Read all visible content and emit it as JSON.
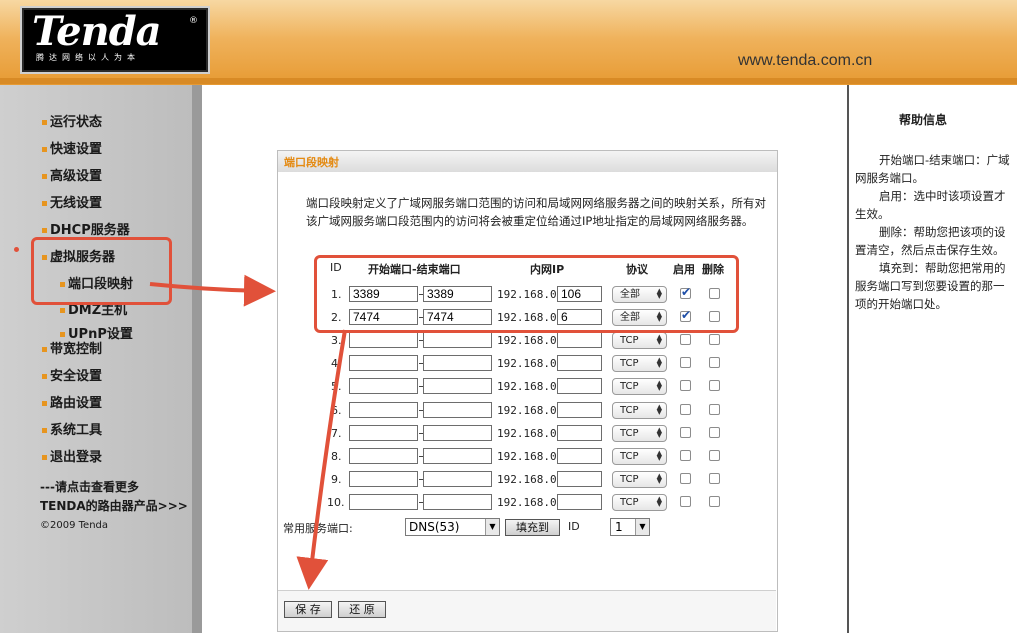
{
  "header": {
    "logo_text": "Tenda",
    "logo_reg": "®",
    "logo_sub": "腾达网络以人为本",
    "site_url": "www.tenda.com.cn"
  },
  "sidebar": {
    "items": [
      {
        "label": "运行状态"
      },
      {
        "label": "快速设置"
      },
      {
        "label": "高级设置"
      },
      {
        "label": "无线设置"
      },
      {
        "label": "DHCP服务器"
      },
      {
        "label": "虚拟服务器"
      },
      {
        "label": "端口段映射"
      },
      {
        "label": "DMZ主机"
      },
      {
        "label": "UPnP设置"
      },
      {
        "label": "带宽控制"
      },
      {
        "label": "安全设置"
      },
      {
        "label": "路由设置"
      },
      {
        "label": "系统工具"
      },
      {
        "label": "退出登录"
      }
    ],
    "more_line1": "---请点击查看更多",
    "more_line2": "TENDA的路由器产品>>>",
    "copyright": "©2009 Tenda"
  },
  "panel": {
    "title": "端口段映射",
    "description": "端口段映射定义了广域网服务端口范围的访问和局域网网络服务器之间的映射关系，所有对该广域网服务端口段范围内的访问将会被重定位给通过IP地址指定的局域网网络服务器。",
    "columns": {
      "id": "ID",
      "ports": "开始端口-结束端口",
      "ip": "内网IP",
      "protocol": "协议",
      "enable": "启用",
      "delete": "删除"
    },
    "ip_prefix": "192.168.0.",
    "rows": [
      {
        "id": "1.",
        "start": "3389",
        "end": "3389",
        "ip": "106",
        "protocol": "全部",
        "enabled": true,
        "deleted": false
      },
      {
        "id": "2.",
        "start": "7474",
        "end": "7474",
        "ip": "6",
        "protocol": "全部",
        "enabled": true,
        "deleted": false
      },
      {
        "id": "3.",
        "start": "",
        "end": "",
        "ip": "",
        "protocol": "TCP",
        "enabled": false,
        "deleted": false
      },
      {
        "id": "4.",
        "start": "",
        "end": "",
        "ip": "",
        "protocol": "TCP",
        "enabled": false,
        "deleted": false
      },
      {
        "id": "5.",
        "start": "",
        "end": "",
        "ip": "",
        "protocol": "TCP",
        "enabled": false,
        "deleted": false
      },
      {
        "id": "6.",
        "start": "",
        "end": "",
        "ip": "",
        "protocol": "TCP",
        "enabled": false,
        "deleted": false
      },
      {
        "id": "7.",
        "start": "",
        "end": "",
        "ip": "",
        "protocol": "TCP",
        "enabled": false,
        "deleted": false
      },
      {
        "id": "8.",
        "start": "",
        "end": "",
        "ip": "",
        "protocol": "TCP",
        "enabled": false,
        "deleted": false
      },
      {
        "id": "9.",
        "start": "",
        "end": "",
        "ip": "",
        "protocol": "TCP",
        "enabled": false,
        "deleted": false
      },
      {
        "id": "10.",
        "start": "",
        "end": "",
        "ip": "",
        "protocol": "TCP",
        "enabled": false,
        "deleted": false
      }
    ],
    "common_service_label": "常用服务端口:",
    "common_service_value": "DNS(53)",
    "fill_button": "填充到",
    "id_label": "ID",
    "id_value": "1",
    "save_button": "保 存",
    "restore_button": "还 原"
  },
  "help": {
    "title": "帮助信息",
    "paragraphs": [
      "开始端口-结束端口：广域网服务端口。",
      "启用：选中时该项设置才生效。",
      "删除：帮助您把该项的设置清空，然后点击保存生效。",
      "填充到：帮助您把常用的服务端口写到您要设置的那一项的开始端口处。"
    ]
  },
  "colors": {
    "accent_orange": "#e48a12",
    "annotation_red": "#e1513a",
    "check_blue": "#1f4fa8"
  }
}
